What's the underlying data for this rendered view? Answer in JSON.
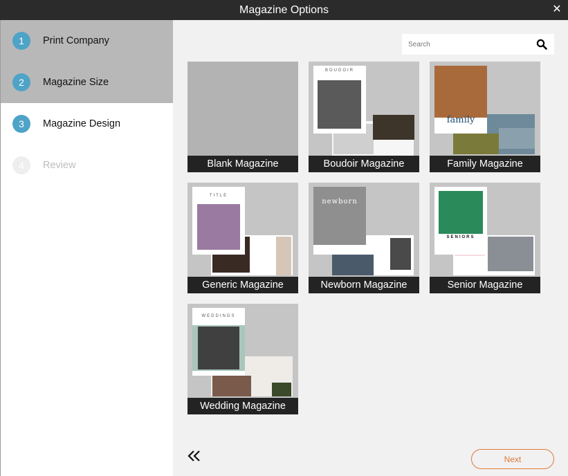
{
  "window": {
    "title": "Magazine Options",
    "close_symbol": "✕"
  },
  "steps": [
    {
      "number": "1",
      "label": "Print Company",
      "state": "completed"
    },
    {
      "number": "2",
      "label": "Magazine Size",
      "state": "completed"
    },
    {
      "number": "3",
      "label": "Magazine Design",
      "state": "current"
    },
    {
      "number": "4",
      "label": "Review",
      "state": "upcoming"
    }
  ],
  "search": {
    "placeholder": "Search",
    "icon": "search-icon"
  },
  "templates": [
    {
      "label": "Blank Magazine"
    },
    {
      "label": "Boudoir Magazine",
      "cover_text": "BOUDOIR"
    },
    {
      "label": "Family Magazine",
      "cover_text": "family"
    },
    {
      "label": "Generic Magazine",
      "cover_text": "TITLE"
    },
    {
      "label": "Newborn Magazine",
      "cover_text": "newborn"
    },
    {
      "label": "Senior Magazine",
      "cover_text": "SENIORS"
    },
    {
      "label": "Wedding Magazine",
      "cover_text": "WEDDINGS"
    }
  ],
  "footer": {
    "back_icon": "double-chevron-left-icon",
    "next_label": "Next"
  },
  "colors": {
    "accent": "#4ea3c7",
    "next_button": "#e07a3a",
    "titlebar": "#2b2b2b"
  }
}
